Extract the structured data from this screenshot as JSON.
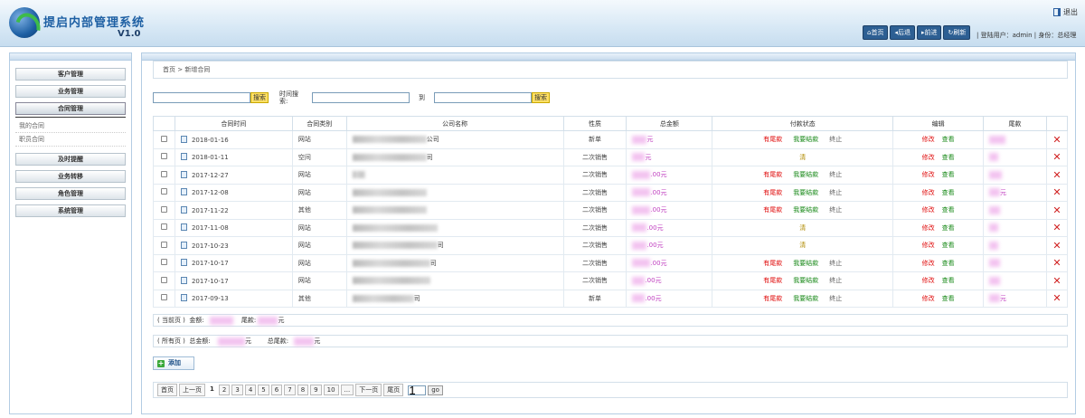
{
  "app": {
    "title": "提启内部管理系统",
    "version": "V1.0"
  },
  "header": {
    "logout": "退出",
    "nav": [
      "首页",
      "后退",
      "前进",
      "刷新"
    ],
    "user_label": "登陆用户：",
    "user": "admin",
    "role_label": "身份：",
    "role": "总经理"
  },
  "sidebar": {
    "items": [
      {
        "label": "客户管理"
      },
      {
        "label": "业务管理"
      },
      {
        "label": "合同管理"
      },
      {
        "label": "及时提醒"
      },
      {
        "label": "业务转移"
      },
      {
        "label": "角色管理"
      },
      {
        "label": "系统管理"
      }
    ],
    "subitems": [
      {
        "label": "我的合同"
      },
      {
        "label": "职员合同"
      }
    ]
  },
  "breadcrumb": {
    "home": "首页",
    "sep": " > ",
    "current": "新增合同"
  },
  "search": {
    "button": "搜索",
    "time_label": "时间搜索:",
    "to": "到"
  },
  "table": {
    "headers": [
      "合同时间",
      "合同类别",
      "公司名称",
      "性质",
      "总金额",
      "付款状态",
      "编辑",
      "尾款"
    ],
    "rows": [
      {
        "date": "2018-01-16",
        "type": "网站",
        "company_suffix": "公司",
        "nature": "新单",
        "amount_suffix": "元",
        "status": "three",
        "tail_suffix": ""
      },
      {
        "date": "2018-01-11",
        "type": "空间",
        "company_suffix": "司",
        "nature": "二次销售",
        "amount_suffix": "元",
        "status": "clear",
        "tail_suffix": ""
      },
      {
        "date": "2017-12-27",
        "type": "网站",
        "company_suffix": "",
        "nature": "二次销售",
        "amount_suffix": ".00元",
        "status": "three",
        "tail_suffix": ""
      },
      {
        "date": "2017-12-08",
        "type": "网站",
        "company_suffix": "",
        "nature": "二次销售",
        "amount_suffix": ".00元",
        "status": "three",
        "tail_suffix": "元"
      },
      {
        "date": "2017-11-22",
        "type": "其他",
        "company_suffix": "",
        "nature": "二次销售",
        "amount_suffix": ".00元",
        "status": "three",
        "tail_suffix": ""
      },
      {
        "date": "2017-11-08",
        "type": "网站",
        "company_suffix": "",
        "nature": "二次销售",
        "amount_suffix": ".00元",
        "status": "clear",
        "tail_suffix": ""
      },
      {
        "date": "2017-10-23",
        "type": "网站",
        "company_suffix": "司",
        "nature": "二次销售",
        "amount_suffix": ".00元",
        "status": "clear",
        "tail_suffix": ""
      },
      {
        "date": "2017-10-17",
        "type": "网站",
        "company_suffix": "司",
        "nature": "二次销售",
        "amount_suffix": ".00元",
        "status": "three",
        "tail_suffix": ""
      },
      {
        "date": "2017-10-17",
        "type": "网站",
        "company_suffix": "",
        "nature": "二次销售",
        "amount_suffix": ".00元",
        "status": "three",
        "tail_suffix": ""
      },
      {
        "date": "2017-09-13",
        "type": "其他",
        "company_suffix": "司",
        "nature": "新单",
        "amount_suffix": ".00元",
        "status": "three",
        "tail_suffix": "元"
      }
    ],
    "status_labels": {
      "has_tail": "有尾款",
      "settle": "我要结款",
      "end": "终止",
      "clear": "清"
    },
    "edit_labels": {
      "edit": "修改",
      "view": "查看"
    }
  },
  "summary": {
    "current": "( 当前页 )",
    "amount_label": "金额:",
    "tail_label": "尾款:",
    "yuan": "元",
    "all": "( 所有页 )",
    "total_amount_label": "总金额:",
    "total_tail_label": "总尾款:"
  },
  "add_button": "添加",
  "pager": {
    "first": "首页",
    "prev": "上一页",
    "pages": [
      "1",
      "2",
      "3",
      "4",
      "5",
      "6",
      "7",
      "8",
      "9",
      "10",
      "..."
    ],
    "next": "下一页",
    "last": "尾页",
    "input": "1",
    "go": "go"
  }
}
